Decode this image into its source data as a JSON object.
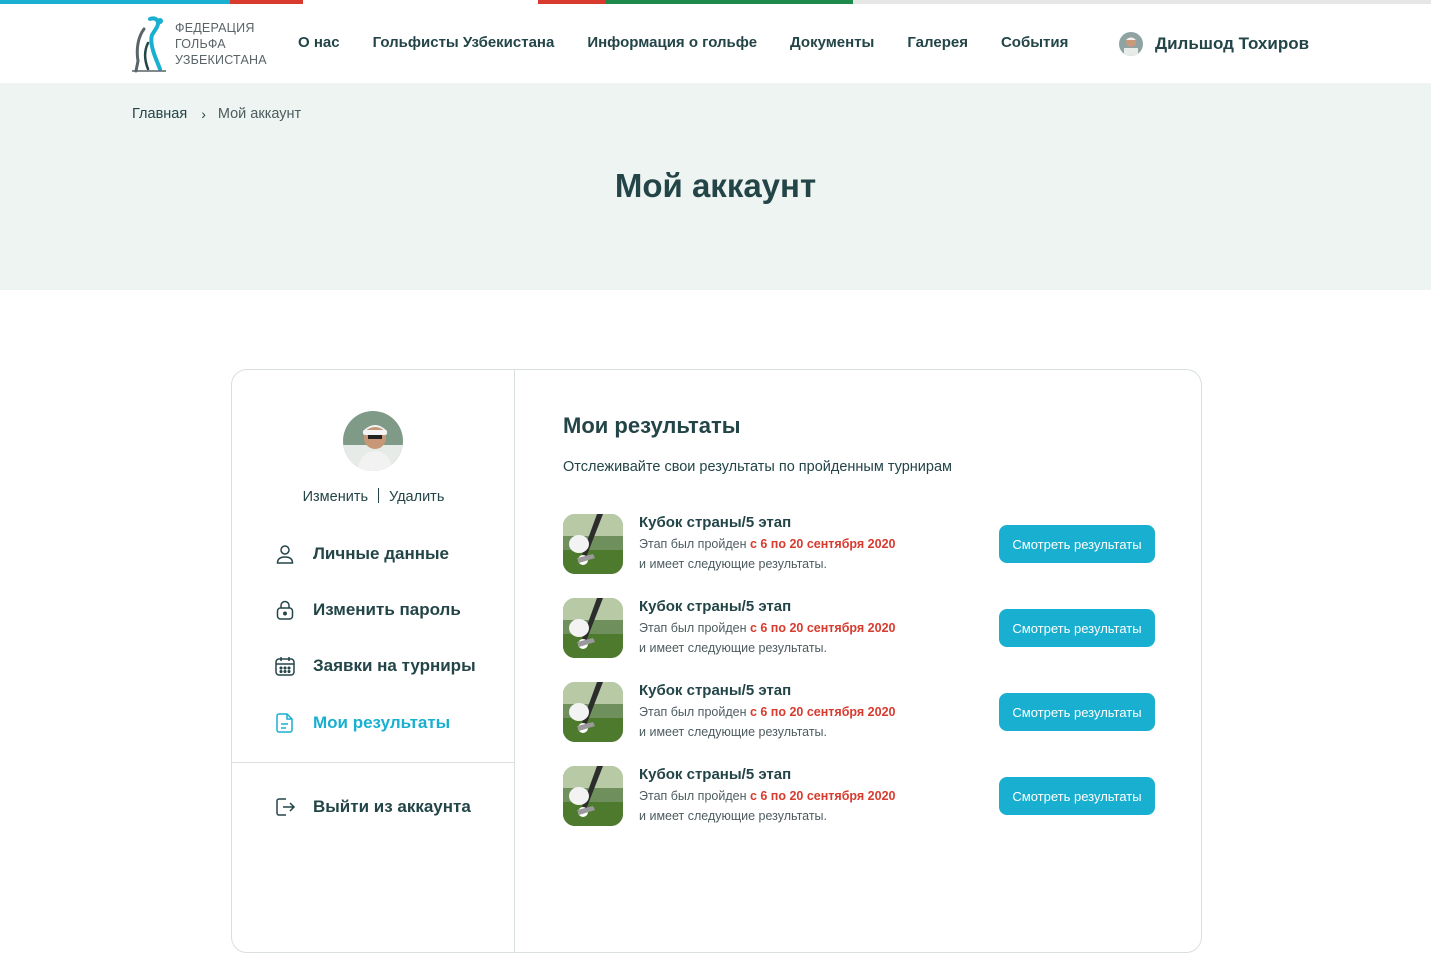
{
  "colors": {
    "accent": "#19afd0",
    "dark": "#234548",
    "red": "#d83a2e",
    "hero_bg": "#eef4f1",
    "top_strip": [
      "#19afd0",
      "#d83a2e",
      "#ffffff",
      "#d83a2e",
      "#1e8a4c",
      "#e6e6e6"
    ]
  },
  "header": {
    "logo_lines": [
      "ФЕДЕРАЦИЯ",
      "ГОЛЬФА",
      "УЗБЕКИСТАНА"
    ],
    "nav": [
      "О нас",
      "Гольфисты Узбекистана",
      "Информация о гольфе",
      "Документы",
      "Галерея",
      "События"
    ],
    "user_name": "Дильшод Тохиров"
  },
  "breadcrumbs": {
    "home": "Главная",
    "separator": "›",
    "current": "Мой аккаунт"
  },
  "page_title": "Мой аккаунт",
  "sidebar": {
    "photo_edit": "Изменить",
    "photo_delete": "Удалить",
    "items": [
      {
        "label": "Личные данные",
        "icon": "user-icon",
        "active": false
      },
      {
        "label": "Изменить пароль",
        "icon": "lock-icon",
        "active": false
      },
      {
        "label": "Заявки на турниры",
        "icon": "calendar-icon",
        "active": false
      },
      {
        "label": "Мои результаты",
        "icon": "document-icon",
        "active": true
      }
    ],
    "logout": {
      "label": "Выйти из аккаунта",
      "icon": "logout-icon"
    }
  },
  "main": {
    "title": "Мои результаты",
    "subtitle": "Отслеживайте свои результаты по пройденным турнирам",
    "results": [
      {
        "title": "Кубок страны/5 этап",
        "line1_prefix": "Этап был пройден ",
        "dates": "с 6 по 20 сентября 2020",
        "line2": "и имеет следующие результаты.",
        "button": "Смотреть результаты"
      },
      {
        "title": "Кубок страны/5 этап",
        "line1_prefix": "Этап был пройден ",
        "dates": "с 6 по 20 сентября 2020",
        "line2": "и имеет следующие результаты.",
        "button": "Смотреть результаты"
      },
      {
        "title": "Кубок страны/5 этап",
        "line1_prefix": "Этап был пройден ",
        "dates": "с 6 по 20 сентября 2020",
        "line2": "и имеет следующие результаты.",
        "button": "Смотреть результаты"
      },
      {
        "title": "Кубок страны/5 этап",
        "line1_prefix": "Этап был пройден ",
        "dates": "с 6 по 20 сентября 2020",
        "line2": "и имеет следующие результаты.",
        "button": "Смотреть результаты"
      }
    ]
  }
}
